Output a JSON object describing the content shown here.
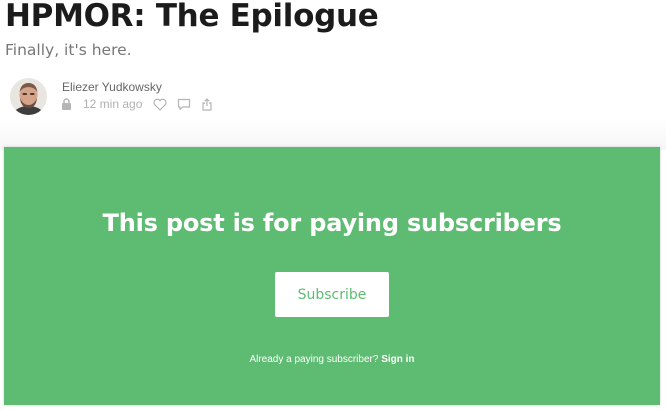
{
  "post": {
    "title": "HPMOR: The Epilogue",
    "subtitle": "Finally, it's here.",
    "author": "Eliezer Yudkowsky",
    "timestamp": "12 min ago",
    "icons": [
      "lock-icon",
      "heart-icon",
      "comment-icon",
      "share-icon"
    ]
  },
  "paywall": {
    "heading": "This post is for paying subscribers",
    "button_label": "Subscribe",
    "signin_prompt": "Already a paying subscriber?",
    "signin_link": "Sign in",
    "background_color": "#5dbc71",
    "button_text_color": "#5dbc71"
  }
}
